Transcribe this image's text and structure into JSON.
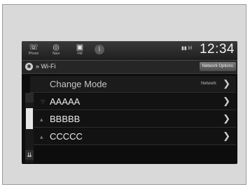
{
  "status_bar": {
    "phone_label": "Phone",
    "navi_label": "Navi",
    "fm_label": "FM",
    "signal_text": "▮▮ lrl",
    "clock": "12:34"
  },
  "header": {
    "breadcrumb": "» Wi-Fi",
    "network_options_label": "Network Options"
  },
  "list": {
    "change_mode": {
      "label": "Change Mode",
      "value": "Network"
    },
    "networks": [
      "AAAAA",
      "BBBBB",
      "CCCCC"
    ]
  },
  "colors": {
    "screen_bg": "#0d0d0d",
    "frame_bg": "#d9d9d9"
  }
}
